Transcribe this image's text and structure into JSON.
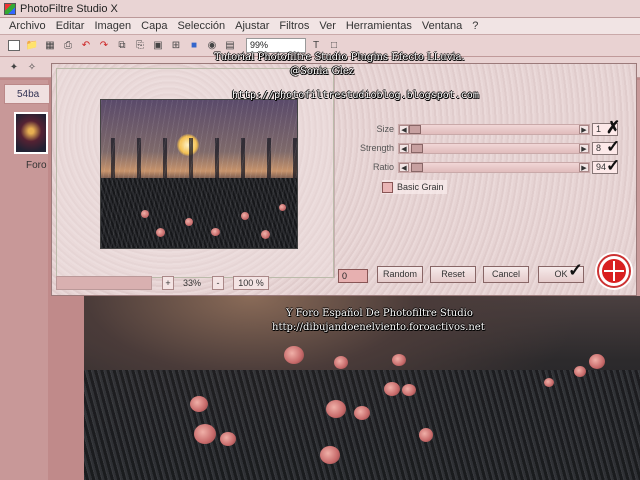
{
  "window": {
    "title": "PhotoFiltre Studio X"
  },
  "menu": [
    "Archivo",
    "Editar",
    "Imagen",
    "Capa",
    "Selección",
    "Ajustar",
    "Filtros",
    "Ver",
    "Herramientas",
    "Ventana",
    "?"
  ],
  "toolbar": {
    "zoom_value": "99%"
  },
  "document": {
    "tab_label": "54ba",
    "thumb_label": "Foro"
  },
  "captions": {
    "line1": "Tutorial Photofiltre Studio Plugins Efecto LLuvia.",
    "line2": "@Sonia Glez",
    "line3": "http://photofiltrestudioblog.blogspot.com",
    "line4": "Y Foro Español De Photofiltre Studio",
    "line5": "http://dibujandoenelviento.foroactivos.net"
  },
  "dialog": {
    "params": [
      {
        "label": "Size",
        "value": "1"
      },
      {
        "label": "Strength",
        "value": "8"
      },
      {
        "label": "Ratio",
        "value": "94"
      }
    ],
    "basic_grain_label": "Basic Grain",
    "zoom_minus": "-",
    "zoom_plus": "+",
    "zoom_percent": "33%",
    "zoom_100": "100 %",
    "seed_value": "0",
    "buttons": {
      "random": "Random",
      "reset": "Reset",
      "cancel": "Cancel",
      "ok": "OK"
    }
  },
  "colors": {
    "theme_pink": "#c08a8a",
    "target_red": "#d92020"
  }
}
